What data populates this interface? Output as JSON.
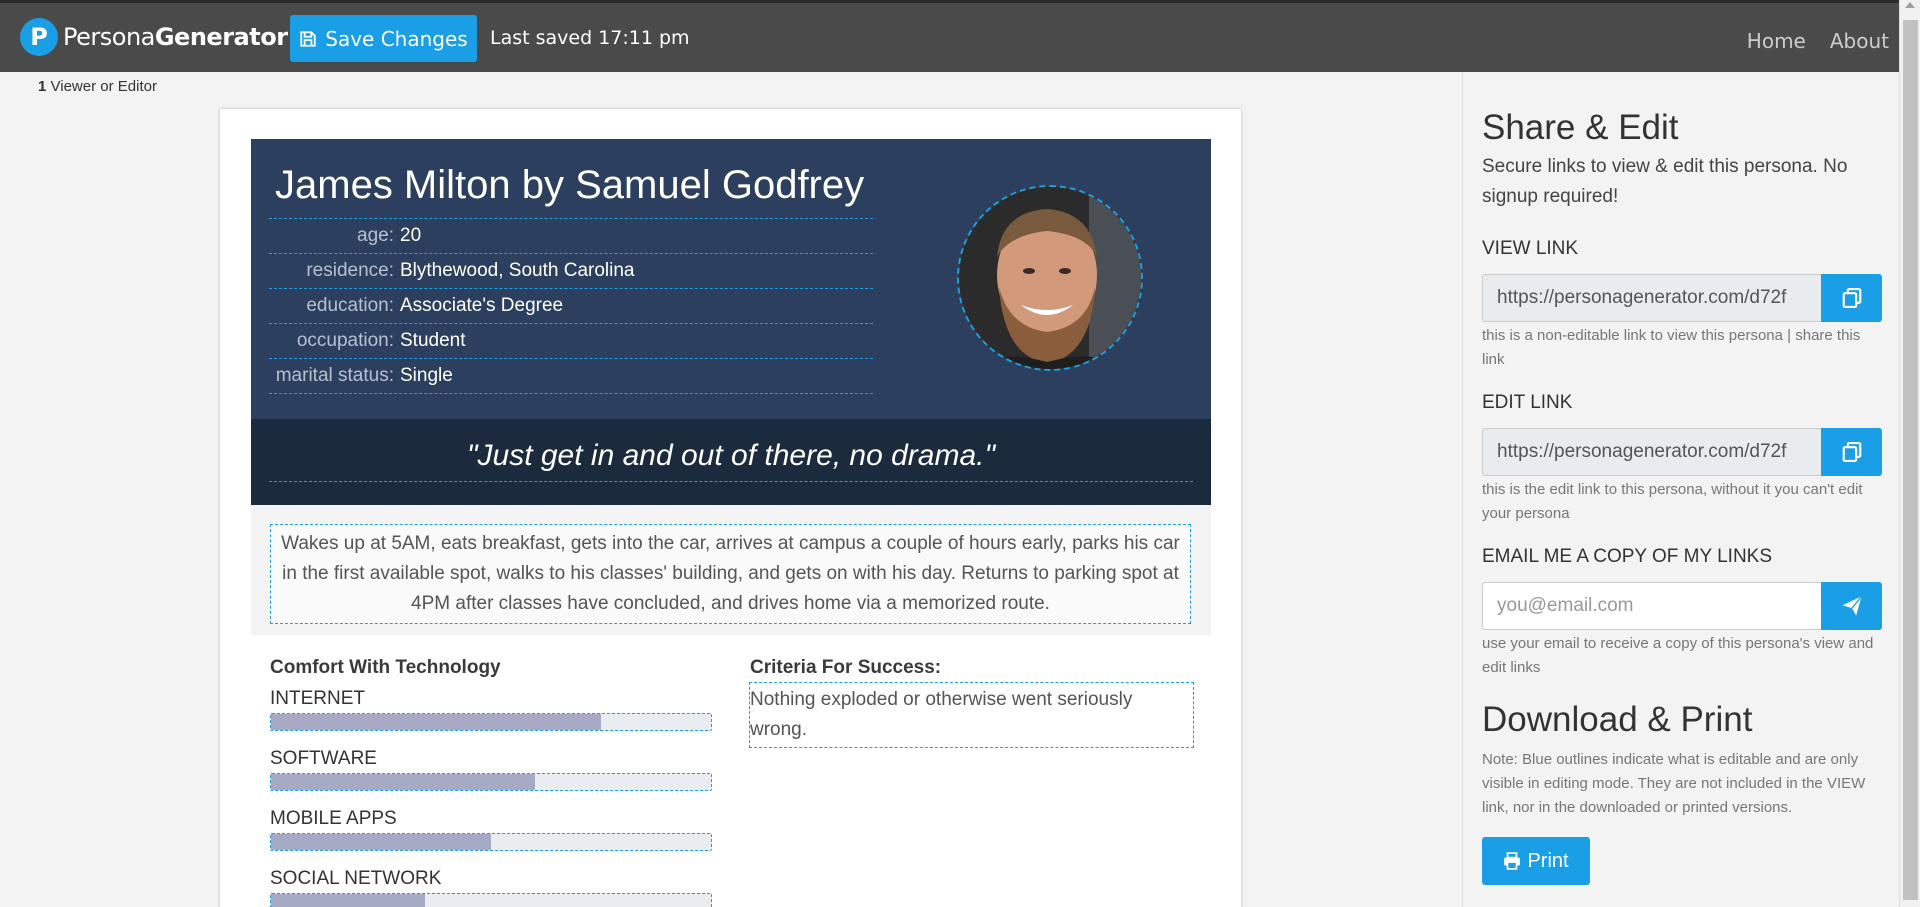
{
  "app": {
    "brand_logo_letter": "P",
    "brand_regular": "Persona",
    "brand_bold": "Generator"
  },
  "toolbar": {
    "save_label": "Save Changes",
    "last_saved": "Last saved 17:11 pm"
  },
  "nav": {
    "home": "Home",
    "about": "About"
  },
  "viewer": {
    "count": "1",
    "label": " Viewer or Editor"
  },
  "persona": {
    "name": "James Milton by Samuel Godfrey",
    "attributes": [
      {
        "label": "age:",
        "value": "20"
      },
      {
        "label": "residence:",
        "value": "Blythewood, South Carolina"
      },
      {
        "label": "education:",
        "value": "Associate's Degree"
      },
      {
        "label": "occupation:",
        "value": "Student"
      },
      {
        "label": "marital status:",
        "value": "Single"
      }
    ],
    "quote": "\"Just get in and out of there, no drama.\"",
    "bio": "Wakes up at 5AM, eats breakfast, gets into the car, arrives at campus a couple of hours early, parks his car in the first available spot, walks to his classes' building, and gets on with his day. Returns to parking spot at 4PM after classes have concluded, and drives home via a memorized route.",
    "tech": {
      "title": "Comfort With Technology",
      "items": [
        {
          "label": "INTERNET",
          "level": 0.75
        },
        {
          "label": "SOFTWARE",
          "level": 0.6
        },
        {
          "label": "MOBILE APPS",
          "level": 0.5
        },
        {
          "label": "SOCIAL NETWORK",
          "level": 0.35
        }
      ]
    },
    "criteria": {
      "title": "Criteria For Success:",
      "text": "Nothing exploded or otherwise went seriously wrong."
    }
  },
  "side": {
    "share_title": "Share & Edit",
    "share_desc": "Secure links to view & edit this persona. No signup required!",
    "view_link_label": "VIEW LINK",
    "view_link_value": "https://personagenerator.com/d72f",
    "view_link_help": "this is a non-editable link to view this persona | share this link",
    "edit_link_label": "EDIT LINK",
    "edit_link_value": "https://personagenerator.com/d72f",
    "edit_link_help": "this is the edit link to this persona, without it you can't edit your persona",
    "email_label": "EMAIL ME A COPY OF MY LINKS",
    "email_placeholder": "you@email.com",
    "email_help": "use your email to receive a copy of this persona's view and edit links",
    "download_title": "Download & Print",
    "download_note": "Note: Blue outlines indicate what is editable and are only visible in editing mode. They are not included in the VIEW link, nor in the downloaded or printed versions.",
    "print_label": "Print"
  },
  "colors": {
    "accent": "#1a9fe6",
    "navbar": "#4a4a4a",
    "header_block": "#2d3f5e",
    "quote_block": "#1c2a3e",
    "bar_fill": "#a7aac4"
  },
  "icons": {
    "save": "floppy-disk-icon",
    "copy": "copy-icon",
    "send": "paper-plane-icon",
    "print": "printer-icon"
  }
}
